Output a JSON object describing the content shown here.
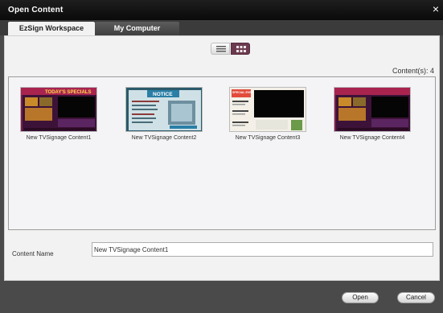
{
  "window": {
    "title": "Open Content",
    "close_label": "×"
  },
  "tabs": [
    {
      "label": "EzSign Workspace",
      "active": true
    },
    {
      "label": "My Computer",
      "active": false
    }
  ],
  "view_toggle": {
    "options": [
      "list-view",
      "grid-view"
    ],
    "selected": "grid-view"
  },
  "content_count": "Content(s): 4",
  "contents": [
    {
      "label": "New TVSignage Content1",
      "thumb_title": "TODAY'S SPECIALS",
      "theme": "specials"
    },
    {
      "label": "New TVSignage Content2",
      "thumb_title": "NOTICE",
      "theme": "notice"
    },
    {
      "label": "New TVSignage Content3",
      "thumb_title": "SPECIAL EVENT",
      "theme": "event"
    },
    {
      "label": "New TVSignage Content4",
      "thumb_title": "",
      "theme": "specials"
    }
  ],
  "content_name": {
    "label": "Content Name",
    "value": "New TVSignage Content1"
  },
  "footer": {
    "open_label": "Open",
    "cancel_label": "Cancel"
  },
  "colors": {
    "accent_grid": "#6b3a4e",
    "titlebar": "#111111",
    "background": "#4a4a4a"
  }
}
